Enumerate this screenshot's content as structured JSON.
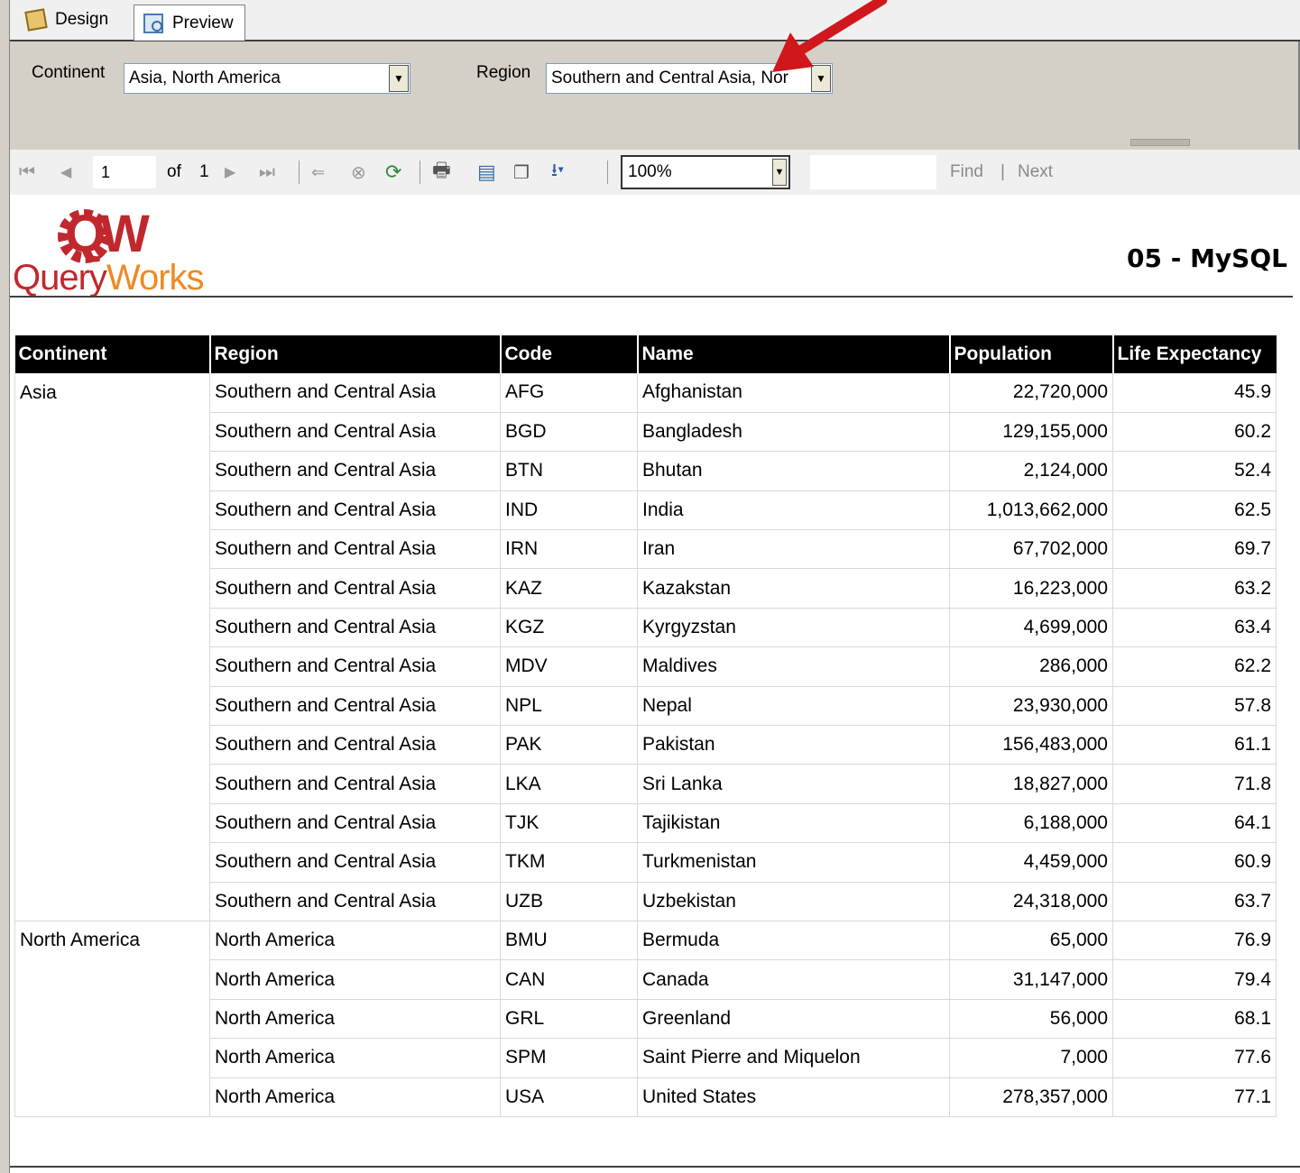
{
  "tabs": {
    "design": "Design",
    "preview": "Preview"
  },
  "params": {
    "continent_label": "Continent",
    "continent_value": "Asia, North America",
    "region_label": "Region",
    "region_value": "Southern and Central Asia, Nor"
  },
  "toolbar": {
    "page_current": "1",
    "page_of": "of",
    "page_total": "1",
    "zoom": "100%",
    "find": "Find",
    "divider": "|",
    "next": "Next"
  },
  "logo": {
    "mark": "QW",
    "brand_part1": "Query",
    "brand_part2": "Works"
  },
  "report_title": "05 - MySQL",
  "table": {
    "columns": [
      "Continent",
      "Region",
      "Code",
      "Name",
      "Population",
      "Life Expectancy"
    ],
    "rows": [
      [
        "Asia",
        "Southern and Central Asia",
        "AFG",
        "Afghanistan",
        "22,720,000",
        "45.9"
      ],
      [
        "",
        "Southern and Central Asia",
        "BGD",
        "Bangladesh",
        "129,155,000",
        "60.2"
      ],
      [
        "",
        "Southern and Central Asia",
        "BTN",
        "Bhutan",
        "2,124,000",
        "52.4"
      ],
      [
        "",
        "Southern and Central Asia",
        "IND",
        "India",
        "1,013,662,000",
        "62.5"
      ],
      [
        "",
        "Southern and Central Asia",
        "IRN",
        "Iran",
        "67,702,000",
        "69.7"
      ],
      [
        "",
        "Southern and Central Asia",
        "KAZ",
        "Kazakstan",
        "16,223,000",
        "63.2"
      ],
      [
        "",
        "Southern and Central Asia",
        "KGZ",
        "Kyrgyzstan",
        "4,699,000",
        "63.4"
      ],
      [
        "",
        "Southern and Central Asia",
        "MDV",
        "Maldives",
        "286,000",
        "62.2"
      ],
      [
        "",
        "Southern and Central Asia",
        "NPL",
        "Nepal",
        "23,930,000",
        "57.8"
      ],
      [
        "",
        "Southern and Central Asia",
        "PAK",
        "Pakistan",
        "156,483,000",
        "61.1"
      ],
      [
        "",
        "Southern and Central Asia",
        "LKA",
        "Sri Lanka",
        "18,827,000",
        "71.8"
      ],
      [
        "",
        "Southern and Central Asia",
        "TJK",
        "Tajikistan",
        "6,188,000",
        "64.1"
      ],
      [
        "",
        "Southern and Central Asia",
        "TKM",
        "Turkmenistan",
        "4,459,000",
        "60.9"
      ],
      [
        "",
        "Southern and Central Asia",
        "UZB",
        "Uzbekistan",
        "24,318,000",
        "63.7"
      ],
      [
        "North America",
        "North America",
        "BMU",
        "Bermuda",
        "65,000",
        "76.9"
      ],
      [
        "",
        "North America",
        "CAN",
        "Canada",
        "31,147,000",
        "79.4"
      ],
      [
        "",
        "North America",
        "GRL",
        "Greenland",
        "56,000",
        "68.1"
      ],
      [
        "",
        "North America",
        "SPM",
        "Saint Pierre and Miquelon",
        "7,000",
        "77.6"
      ],
      [
        "",
        "North America",
        "USA",
        "United States",
        "278,357,000",
        "77.1"
      ]
    ]
  },
  "colors": {
    "logo_red": "#c0282e",
    "logo_orange": "#ef8a24",
    "annotation_arrow": "#d0181c",
    "header_bg": "#000000"
  }
}
